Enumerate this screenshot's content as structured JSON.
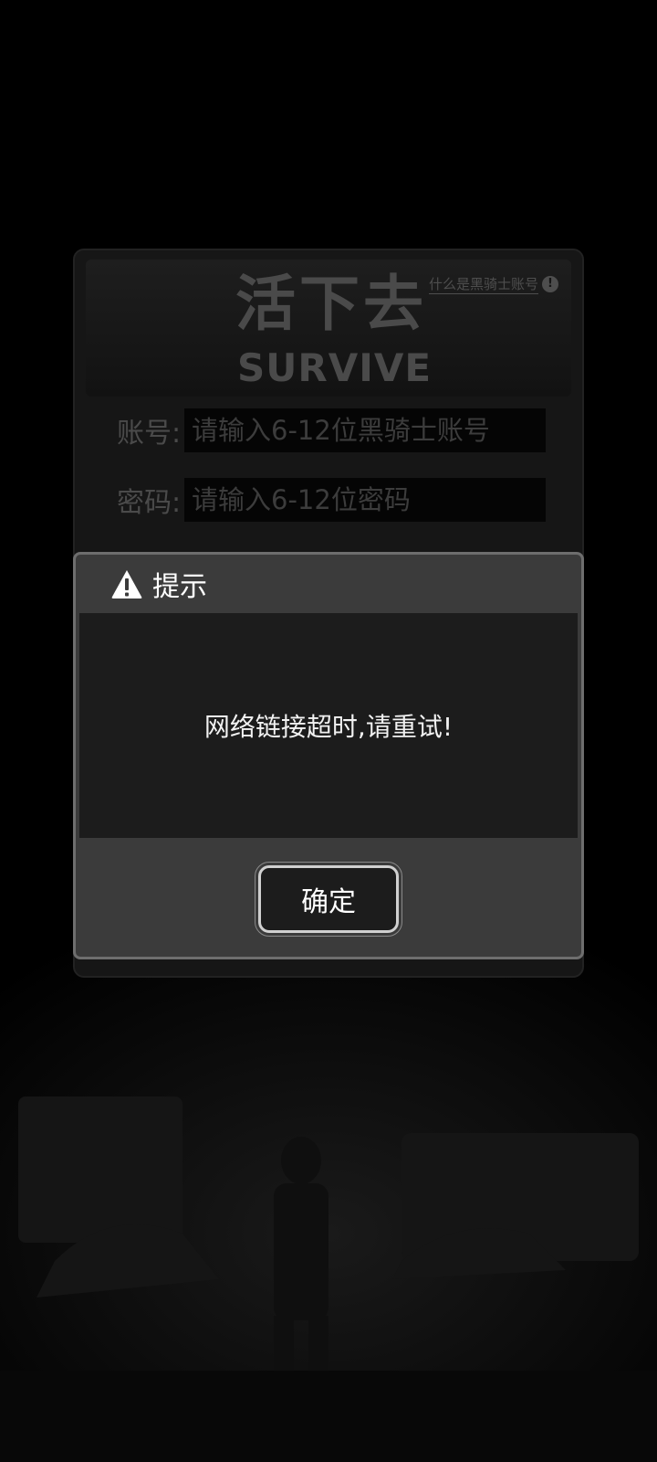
{
  "login": {
    "logo_cn": "活下去",
    "logo_en": "SURVIVE",
    "help_link": "什么是黑骑士账号",
    "account_label": "账号:",
    "account_placeholder": "请输入6-12位黑骑士账号",
    "password_label": "密码:",
    "password_placeholder": "请输入6-12位密码"
  },
  "dialog": {
    "icon": "warning-icon",
    "title": "提示",
    "message": "网络链接超时,请重试!",
    "confirm_label": "确定"
  },
  "colors": {
    "background": "#000000",
    "dialog_header": "#3b3b3b",
    "dialog_body": "#1c1c1c",
    "dialog_border": "#6e6e6e",
    "text": "#ffffff"
  }
}
